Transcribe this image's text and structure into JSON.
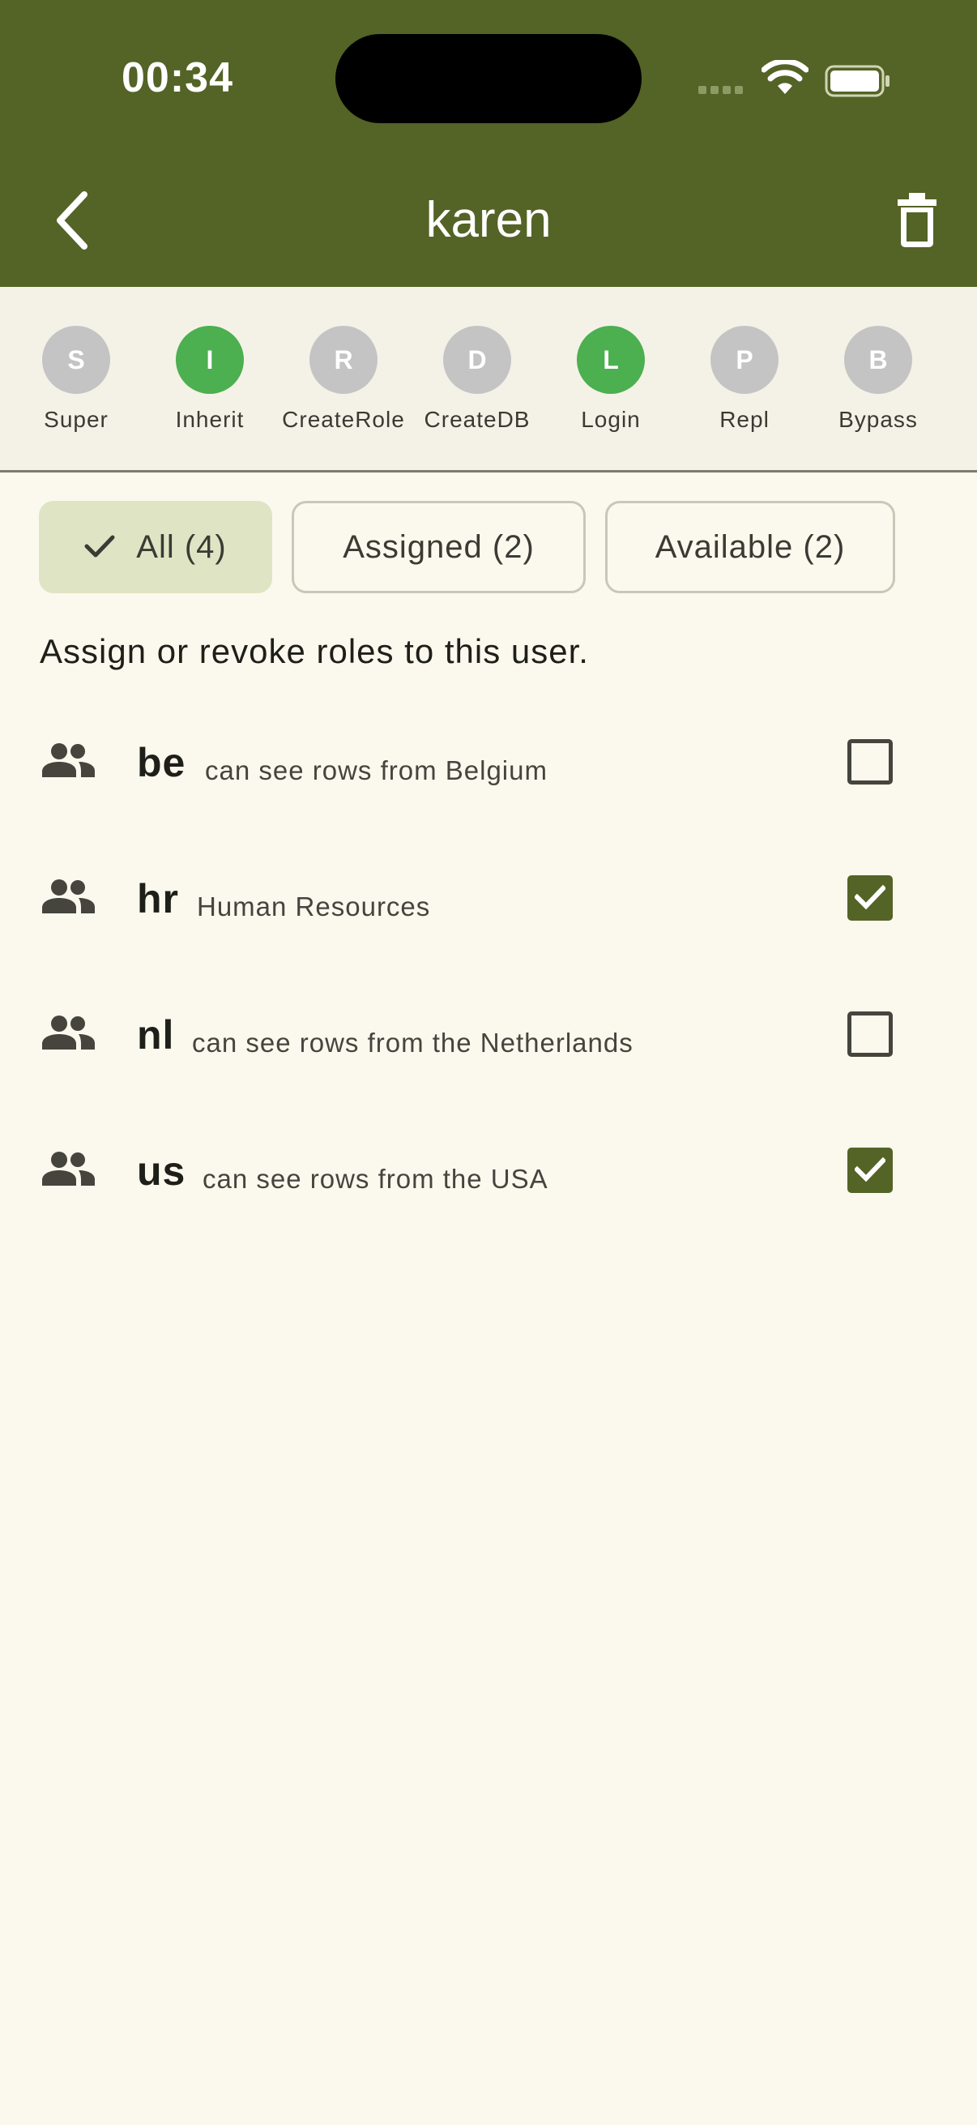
{
  "status_bar": {
    "time": "00:34"
  },
  "header": {
    "title": "karen"
  },
  "attributes": [
    {
      "letter": "S",
      "label": "Super",
      "active": false
    },
    {
      "letter": "I",
      "label": "Inherit",
      "active": true
    },
    {
      "letter": "R",
      "label": "CreateRole",
      "active": false
    },
    {
      "letter": "D",
      "label": "CreateDB",
      "active": false
    },
    {
      "letter": "L",
      "label": "Login",
      "active": true
    },
    {
      "letter": "P",
      "label": "Repl",
      "active": false
    },
    {
      "letter": "B",
      "label": "Bypass",
      "active": false
    }
  ],
  "filters": [
    {
      "label": "All (4)",
      "selected": true
    },
    {
      "label": "Assigned (2)",
      "selected": false
    },
    {
      "label": "Available (2)",
      "selected": false
    }
  ],
  "hint": "Assign or revoke roles to this user.",
  "roles": [
    {
      "name": "be",
      "description": "can see rows from Belgium",
      "assigned": false
    },
    {
      "name": "hr",
      "description": "Human Resources",
      "assigned": true
    },
    {
      "name": "nl",
      "description": "can see rows from the Netherlands",
      "assigned": false
    },
    {
      "name": "us",
      "description": "can see rows from the USA",
      "assigned": true
    }
  ],
  "colors": {
    "header": "#546326",
    "accent_active": "#4caf50",
    "background": "#fbf9ee"
  }
}
